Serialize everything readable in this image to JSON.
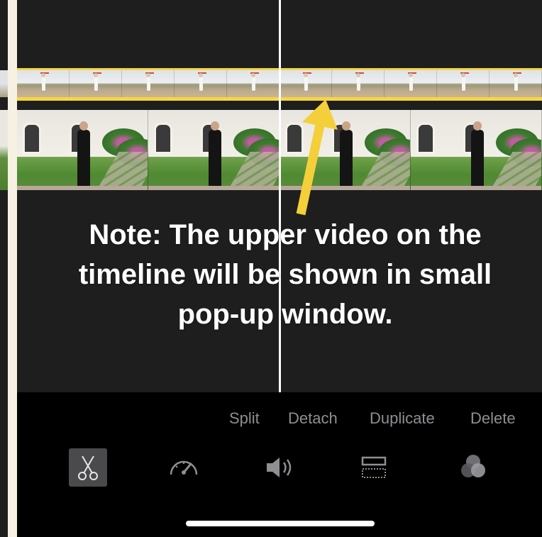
{
  "note": {
    "line1": "Note: The upper video on the",
    "line2": "timeline will be shown in small",
    "line3": "pop-up window."
  },
  "actions": {
    "split": "Split",
    "detach": "Detach",
    "duplicate": "Duplicate",
    "delete": "Delete"
  },
  "tools": [
    {
      "icon": "scissors-icon",
      "active": true
    },
    {
      "icon": "speedometer-icon",
      "active": false
    },
    {
      "icon": "speaker-icon",
      "active": false
    },
    {
      "icon": "titles-icon",
      "active": false
    },
    {
      "icon": "filters-icon",
      "active": false
    }
  ],
  "colors": {
    "timeline_bg": "#1e1e1e",
    "overlay_track_border": "#f6d542",
    "arrow": "#f4cf3a",
    "action_text": "#8e8e93",
    "active_tool_bg": "#4a4a4c"
  }
}
